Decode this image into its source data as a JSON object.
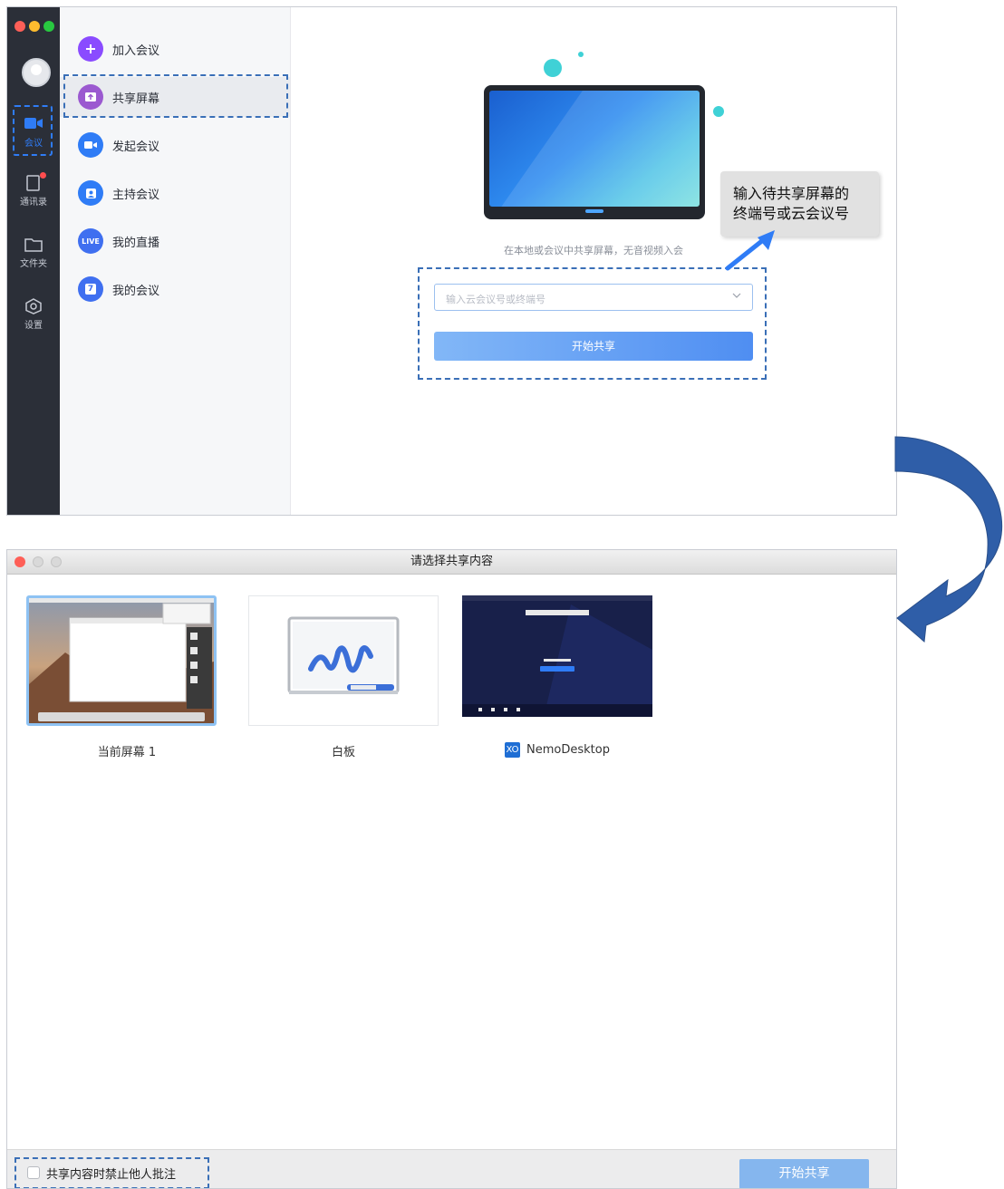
{
  "top_window": {
    "sidebar": {
      "items": [
        {
          "label": "会议",
          "icon": "video-camera-icon"
        },
        {
          "label": "通讯录",
          "icon": "contacts-icon"
        },
        {
          "label": "文件夹",
          "icon": "folder-icon"
        },
        {
          "label": "设置",
          "icon": "settings-icon"
        }
      ]
    },
    "menu": [
      {
        "label": "加入会议",
        "icon": "plus-icon",
        "color": "#8a4bff"
      },
      {
        "label": "共享屏幕",
        "icon": "share-screen-icon",
        "color": "#9b59d0"
      },
      {
        "label": "发起会议",
        "icon": "video-camera-icon",
        "color": "#2f7cf6"
      },
      {
        "label": "主持会议",
        "icon": "host-icon",
        "color": "#2f7cf6"
      },
      {
        "label": "我的直播",
        "icon": "live-icon",
        "badge": "LIVE",
        "color": "#3f6ff0"
      },
      {
        "label": "我的会议",
        "icon": "calendar-icon",
        "badge": "7",
        "color": "#3f6ff0"
      }
    ],
    "callout": {
      "line1": "输入待共享屏幕的",
      "line2": "终端号或云会议号"
    },
    "subtitle": "在本地或会议中共享屏幕，无音视频入会",
    "input_placeholder": "输入云会议号或终端号",
    "start_button": "开始共享"
  },
  "bottom_window": {
    "title": "请选择共享内容",
    "options": [
      {
        "label": "当前屏幕 1"
      },
      {
        "label": "白板"
      },
      {
        "label": "NemoDesktop",
        "icon_badge": "XO"
      }
    ],
    "checkbox_label": "共享内容时禁止他人批注",
    "start_button": "开始共享"
  },
  "colors": {
    "accent": "#2f7cf6",
    "dashed": "#3a6fb7",
    "arrow": "#2f5ea8"
  }
}
